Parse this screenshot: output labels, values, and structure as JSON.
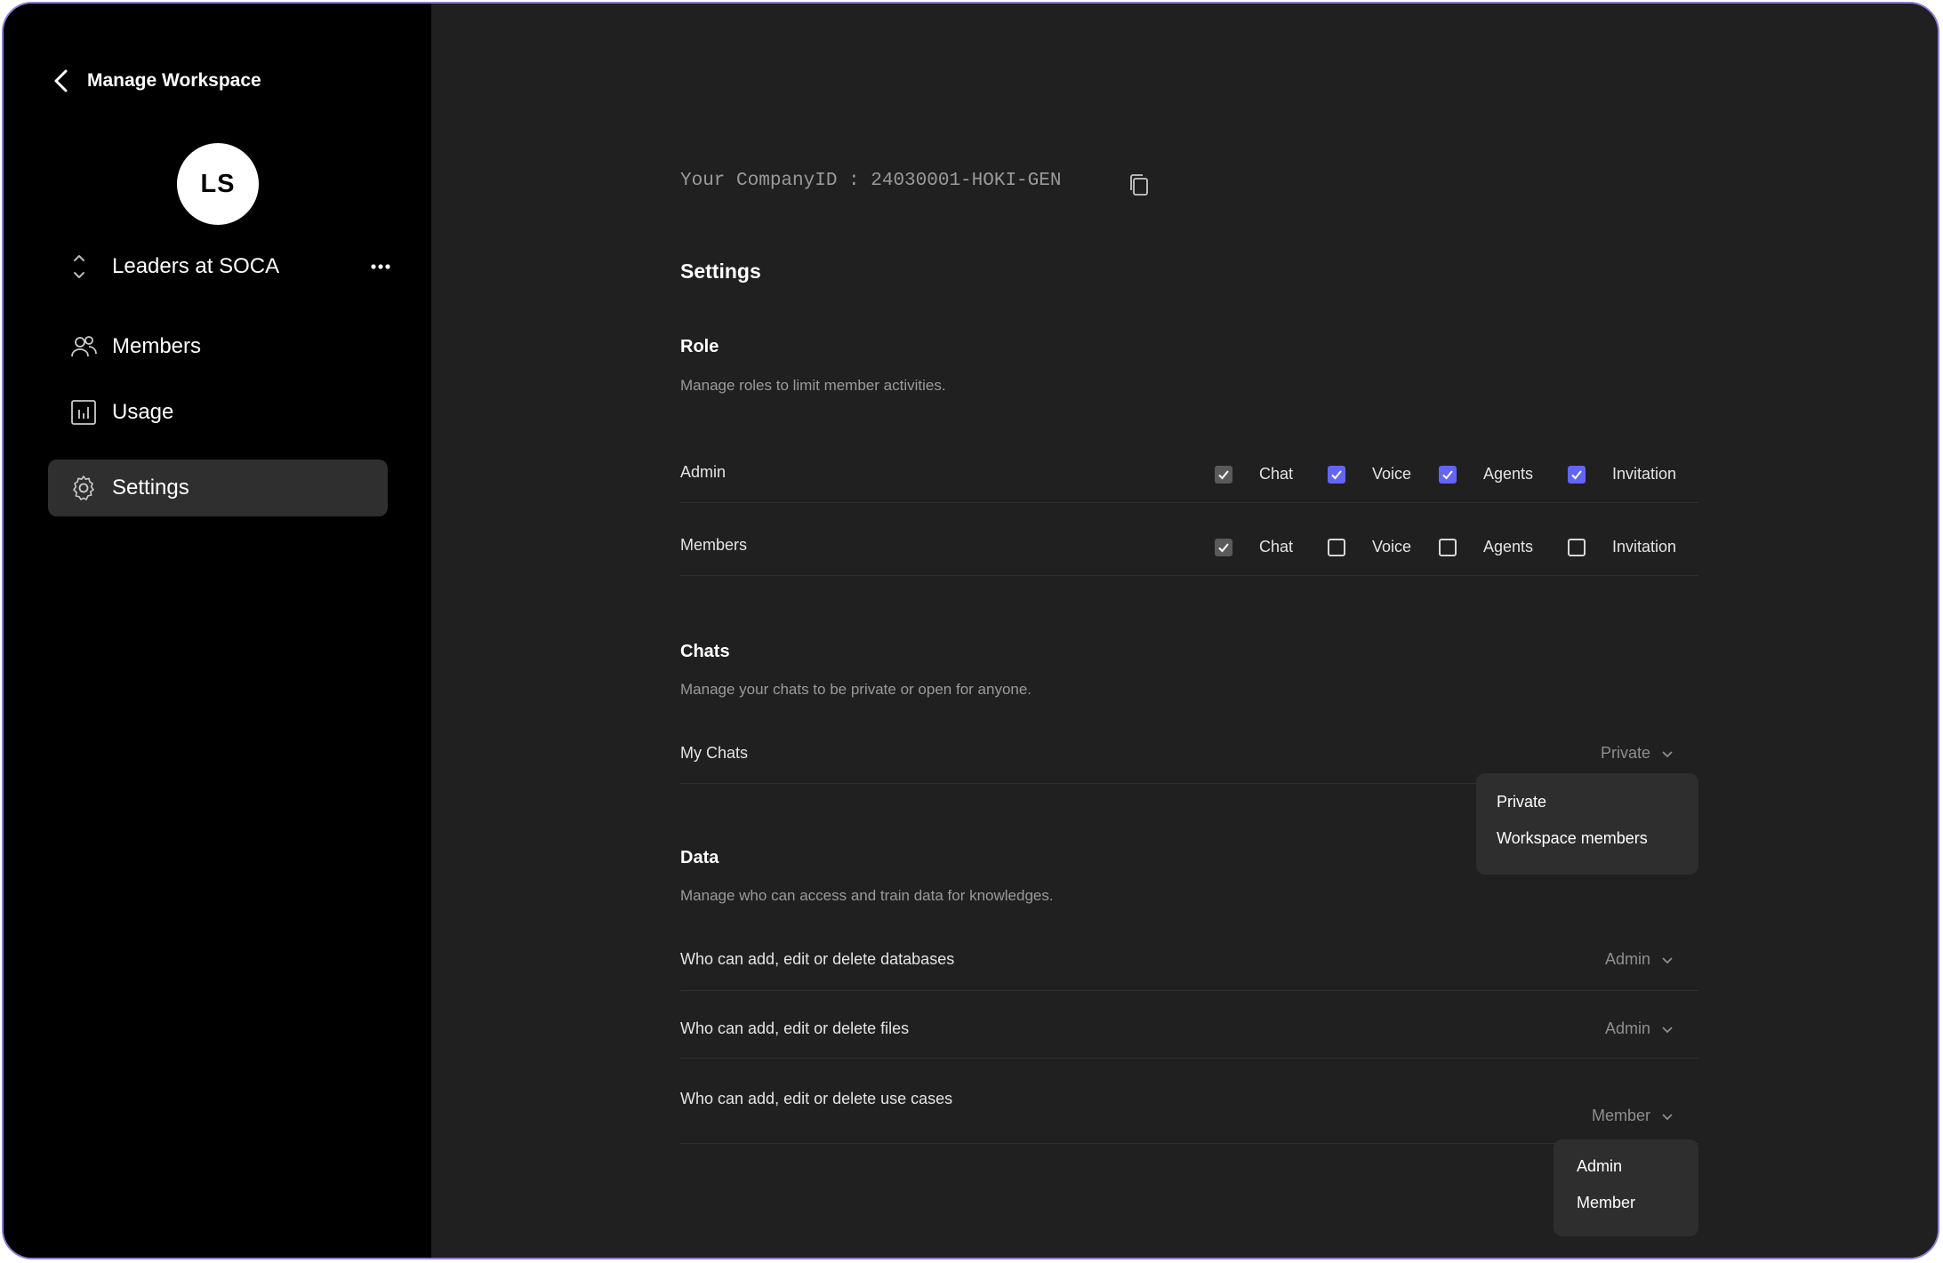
{
  "sidebar": {
    "back_title": "Manage Workspace",
    "avatar_initials": "LS",
    "workspace_name": "Leaders at SOCA",
    "nav": [
      {
        "label": "Members",
        "icon": "users-icon"
      },
      {
        "label": "Usage",
        "icon": "chart-icon"
      },
      {
        "label": "Settings",
        "icon": "gear-icon",
        "active": true
      }
    ]
  },
  "main": {
    "company_id": "Your CompanyID : 24030001-HOKI-GEN",
    "settings_title": "Settings",
    "role": {
      "title": "Role",
      "description": "Manage roles to limit member activities.",
      "permission_labels": [
        "Chat",
        "Voice",
        "Agents",
        "Invitation"
      ],
      "rows": [
        {
          "label": "Admin",
          "checks": [
            "locked",
            "checked",
            "checked",
            "checked"
          ]
        },
        {
          "label": "Members",
          "checks": [
            "locked",
            "unchecked",
            "unchecked",
            "unchecked"
          ]
        }
      ]
    },
    "chats": {
      "title": "Chats",
      "description": "Manage your chats to be private or open for anyone.",
      "row_label": "My Chats",
      "selected": "Private",
      "options": [
        "Private",
        "Workspace members"
      ]
    },
    "data": {
      "title": "Data",
      "description": "Manage who can access and train data for knowledges.",
      "rows": [
        {
          "label": "Who can add, edit or delete databases",
          "selected": "Admin"
        },
        {
          "label": "Who can add, edit or delete files",
          "selected": "Admin"
        },
        {
          "label": "Who can add, edit or delete use cases",
          "selected": "Member"
        }
      ],
      "options": [
        "Admin",
        "Member"
      ]
    }
  },
  "colors": {
    "sidebar_bg": "#000000",
    "main_bg": "#202020",
    "accent": "#6366f1",
    "frame_border": "#8f7bd6"
  }
}
